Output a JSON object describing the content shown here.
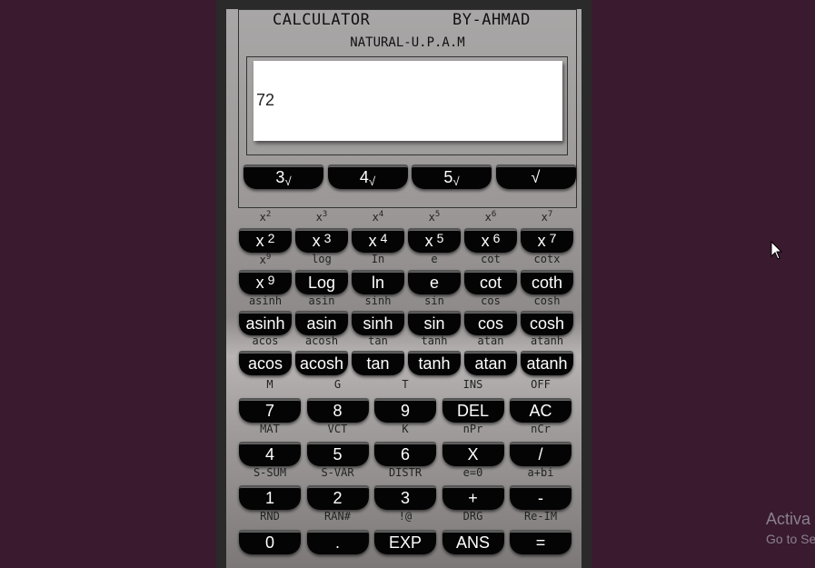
{
  "header": {
    "title": "CALCULATOR",
    "author": "BY-AHMAD",
    "subtitle": "NATURAL-U.P.A.M"
  },
  "display": {
    "value": "72"
  },
  "root_keys": [
    {
      "base": "3",
      "sym": "√"
    },
    {
      "base": "4",
      "sym": "√"
    },
    {
      "base": "5",
      "sym": "√"
    },
    {
      "base": "",
      "sym": "√"
    }
  ],
  "pow_labels": [
    {
      "b": "x",
      "e": "2"
    },
    {
      "b": "x",
      "e": "3"
    },
    {
      "b": "x",
      "e": "4"
    },
    {
      "b": "x",
      "e": "5"
    },
    {
      "b": "x",
      "e": "6"
    },
    {
      "b": "x",
      "e": "7"
    }
  ],
  "pow_keys": [
    {
      "b": "x",
      "e": "2"
    },
    {
      "b": "x",
      "e": "3"
    },
    {
      "b": "x",
      "e": "4"
    },
    {
      "b": "x",
      "e": "5"
    },
    {
      "b": "x",
      "e": "6"
    },
    {
      "b": "x",
      "e": "7"
    }
  ],
  "row2_labels": [
    {
      "b": "x",
      "e": "9"
    },
    "log",
    "In",
    "e",
    "cot",
    "cotx"
  ],
  "row2_keys": [
    {
      "b": "x",
      "e": "9"
    },
    "Log",
    "ln",
    "e",
    "cot",
    "coth"
  ],
  "row3_labels": [
    "asinh",
    "asin",
    "sinh",
    "sin",
    "cos",
    "cosh"
  ],
  "row3_keys": [
    "asinh",
    "asin",
    "sinh",
    "sin",
    "cos",
    "cosh"
  ],
  "row4_labels": [
    "acos",
    "acosh",
    "tan",
    "tanh",
    "atan",
    "atanh"
  ],
  "row4_keys": [
    "acos",
    "acosh",
    "tan",
    "tanh",
    "atan",
    "atanh"
  ],
  "num1_labels": [
    "M",
    "G",
    "T",
    "INS",
    "OFF"
  ],
  "num1_keys": [
    "7",
    "8",
    "9",
    "DEL",
    "AC"
  ],
  "num2_labels": [
    "MAT",
    "VCT",
    "K",
    "nPr",
    "nCr"
  ],
  "num2_keys": [
    "4",
    "5",
    "6",
    "X",
    "/"
  ],
  "num3_labels": [
    "S-SUM",
    "S-VAR",
    "DISTR",
    "e=0",
    "a+bi"
  ],
  "num3_keys": [
    "1",
    "2",
    "3",
    "+",
    "-"
  ],
  "num4_labels": [
    "RND",
    "RAN#",
    "!@",
    "DRG",
    "Re-IM"
  ],
  "num4_keys": [
    "0",
    ".",
    "EXP",
    "ANS",
    "="
  ],
  "watermark": {
    "line1": "Activa",
    "line2": "Go to Se"
  }
}
